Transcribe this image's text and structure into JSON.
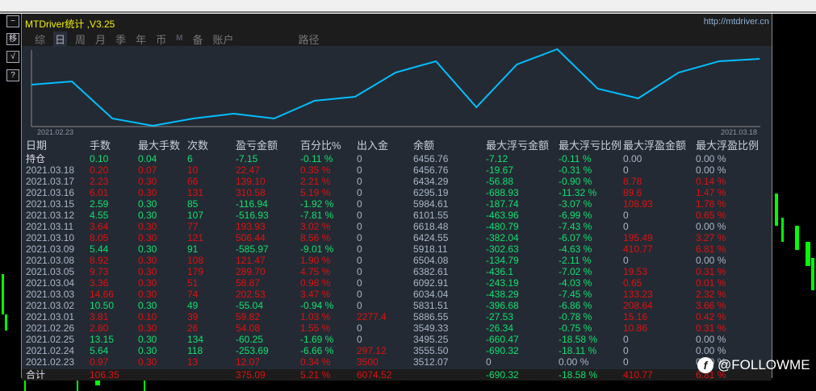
{
  "window": {
    "title": "MTDriver统计 ,V3.25",
    "url": "http://mtdriver.cn"
  },
  "toolbar": {
    "minimize": "−",
    "move": "移",
    "check": "√",
    "help": "?"
  },
  "tabs": [
    {
      "label": "综"
    },
    {
      "label": "日",
      "active": true
    },
    {
      "label": "周"
    },
    {
      "label": "月"
    },
    {
      "label": "季"
    },
    {
      "label": "年"
    },
    {
      "label": "币"
    },
    {
      "label": "M"
    },
    {
      "label": "备"
    },
    {
      "label": "账户"
    },
    {
      "label": "路径"
    }
  ],
  "chart_data": {
    "type": "line",
    "x_start": "2021.02.23",
    "x_end": "2021.03.18",
    "values": [
      55,
      59,
      13,
      4,
      13,
      19,
      13,
      35,
      40,
      70,
      84,
      27,
      80,
      99,
      50,
      38,
      70,
      84,
      87
    ],
    "color": "#00bfff"
  },
  "table": {
    "headers": [
      "日期",
      "手数",
      "最大手数",
      "次数",
      "盈亏金额",
      "百分比%",
      "出入金",
      "余额",
      "最大浮亏金额",
      "最大浮亏比例",
      "最大浮盈金额",
      "最大浮盈比例"
    ],
    "rows": [
      [
        "持仓",
        "0.10",
        "0.04",
        "6",
        "-7.15",
        "-0.11 %",
        "0",
        "6456.76",
        "-7.12",
        "-0.11 %",
        "0.00",
        "0.00 %"
      ],
      [
        "2021.03.18",
        "0.20",
        "0.07",
        "10",
        "22.47",
        "0.35 %",
        "0",
        "6456.76",
        "-19.67",
        "-0.31 %",
        "0",
        "0.00 %"
      ],
      [
        "2021.03.17",
        "2.23",
        "0.30",
        "66",
        "139.10",
        "2.21 %",
        "0",
        "6434.29",
        "-56.88",
        "-0.90 %",
        "8.78",
        "0.14 %"
      ],
      [
        "2021.03.16",
        "6.01",
        "0.30",
        "131",
        "310.58",
        "5.19 %",
        "0",
        "6295.19",
        "-688.93",
        "-11.32 %",
        "89.6",
        "1.47 %"
      ],
      [
        "2021.03.15",
        "2.59",
        "0.30",
        "85",
        "-116.94",
        "-1.92 %",
        "0",
        "5984.61",
        "-187.74",
        "-3.07 %",
        "108.93",
        "1.78 %"
      ],
      [
        "2021.03.12",
        "4.55",
        "0.30",
        "107",
        "-516.93",
        "-7.81 %",
        "0",
        "6101.55",
        "-463.96",
        "-6.99 %",
        "0",
        "0.65 %"
      ],
      [
        "2021.03.11",
        "3.64",
        "0.30",
        "77",
        "193.93",
        "3.02 %",
        "0",
        "6618.48",
        "-480.79",
        "-7.43 %",
        "0",
        "0.00 %"
      ],
      [
        "2021.03.10",
        "8.05",
        "0.30",
        "121",
        "506.44",
        "8.56 %",
        "0",
        "6424.55",
        "-382.04",
        "-6.07 %",
        "195.49",
        "3.27 %"
      ],
      [
        "2021.03.09",
        "5.44",
        "0.30",
        "91",
        "-585.97",
        "-9.01 %",
        "0",
        "5918.11",
        "-302.63",
        "-4.63 %",
        "410.77",
        "6.81 %"
      ],
      [
        "2021.03.08",
        "8.92",
        "0.30",
        "108",
        "121.47",
        "1.90 %",
        "0",
        "6504.08",
        "-134.79",
        "-2.11 %",
        "0",
        "0.00 %"
      ],
      [
        "2021.03.05",
        "9.73",
        "0.30",
        "179",
        "289.70",
        "4.75 %",
        "0",
        "6382.61",
        "-436.1",
        "-7.02 %",
        "19.53",
        "0.31 %"
      ],
      [
        "2021.03.04",
        "3.36",
        "0.30",
        "51",
        "58.87",
        "0.98 %",
        "0",
        "6092.91",
        "-243.19",
        "-4.03 %",
        "0.65",
        "0.01 %"
      ],
      [
        "2021.03.03",
        "14.66",
        "0.30",
        "74",
        "202.53",
        "3.47 %",
        "0",
        "6034.04",
        "-438.29",
        "-7.45 %",
        "133.23",
        "2.32 %"
      ],
      [
        "2021.03.02",
        "10.50",
        "0.30",
        "49",
        "-55.04",
        "-0.94 %",
        "0",
        "5831.51",
        "-396.68",
        "-6.86 %",
        "208.64",
        "3.66 %"
      ],
      [
        "2021.03.01",
        "3.81",
        "0.10",
        "39",
        "59.82",
        "1.03 %",
        "2277.4",
        "5886.55",
        "-27.53",
        "-0.78 %",
        "15.16",
        "0.42 %"
      ],
      [
        "2021.02.26",
        "2.80",
        "0.30",
        "26",
        "54.08",
        "1.55 %",
        "0",
        "3549.33",
        "-26.34",
        "-0.75 %",
        "10.86",
        "0.31 %"
      ],
      [
        "2021.02.25",
        "13.15",
        "0.30",
        "134",
        "-60.25",
        "-1.69 %",
        "0",
        "3495.25",
        "-660.47",
        "-18.58 %",
        "0",
        "0.00 %"
      ],
      [
        "2021.02.24",
        "5.64",
        "0.30",
        "118",
        "-253.69",
        "-6.66 %",
        "297.12",
        "3555.50",
        "-690.32",
        "-18.11 %",
        "0",
        "0.00 %"
      ],
      [
        "2021.02.23",
        "0.97",
        "0.30",
        "13",
        "12.07",
        "0.34 %",
        "3500",
        "3512.07",
        "0",
        "0.00 %",
        "0",
        "0.00 %"
      ]
    ],
    "total": [
      "合计",
      "106.35",
      "",
      "",
      "375.09",
      "5.21 %",
      "6074.52",
      "",
      "-690.32",
      "-18.58 %",
      "410.77",
      "6.81 %"
    ]
  },
  "watermark": "@FOLLOWME",
  "colors": {
    "profit": "#e01010",
    "loss": "#10e070",
    "neutral": "#a9b6c8",
    "line": "#00bfff"
  }
}
